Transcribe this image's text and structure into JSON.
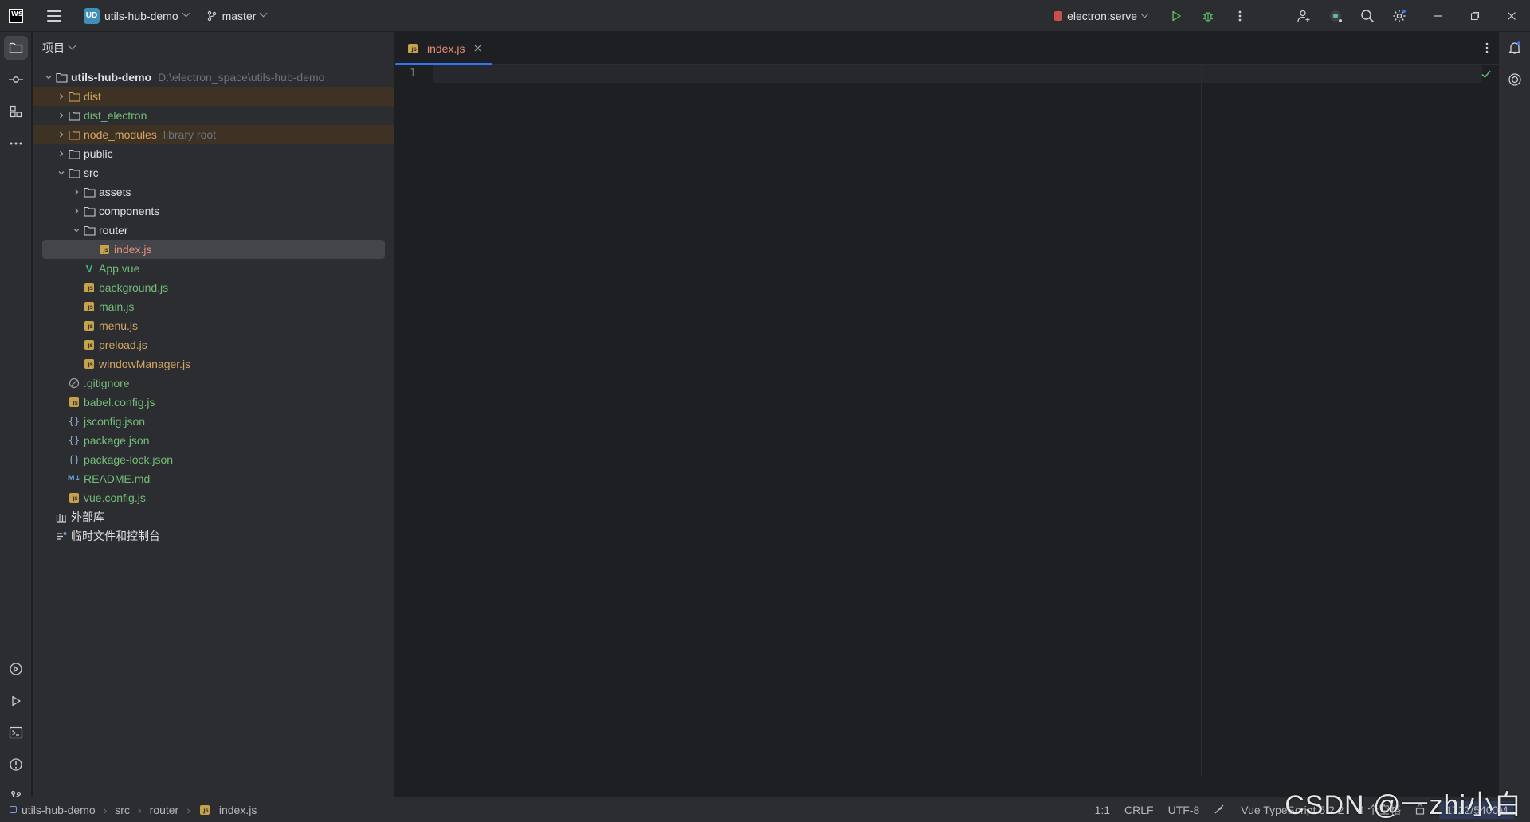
{
  "titlebar": {
    "logo_text": "WS",
    "project_badge": "UD",
    "project_name": "utils-hub-demo",
    "branch": "master",
    "run_config": "electron:serve"
  },
  "panel": {
    "title": "项目"
  },
  "tree": [
    {
      "label": "utils-hub-demo",
      "hint": "D:\\electron_space\\utils-hub-demo"
    },
    {
      "label": "dist"
    },
    {
      "label": "dist_electron"
    },
    {
      "label": "node_modules",
      "hint": "library root"
    },
    {
      "label": "public"
    },
    {
      "label": "src"
    },
    {
      "label": "assets"
    },
    {
      "label": "components"
    },
    {
      "label": "router"
    },
    {
      "label": "index.js"
    },
    {
      "label": "App.vue"
    },
    {
      "label": "background.js"
    },
    {
      "label": "main.js"
    },
    {
      "label": "menu.js"
    },
    {
      "label": "preload.js"
    },
    {
      "label": "windowManager.js"
    },
    {
      "label": ".gitignore"
    },
    {
      "label": "babel.config.js"
    },
    {
      "label": "jsconfig.json"
    },
    {
      "label": "package.json"
    },
    {
      "label": "package-lock.json"
    },
    {
      "label": "README.md"
    },
    {
      "label": "vue.config.js"
    },
    {
      "label": "外部库"
    },
    {
      "label": "临时文件和控制台"
    }
  ],
  "icons": {
    "js_badge": "JS",
    "md_badge": "M↓",
    "json_glyph": "{}",
    "vue_glyph": "V"
  },
  "editor": {
    "tab_label": "index.js",
    "line_number": "1"
  },
  "status": {
    "crumbs": [
      "utils-hub-demo",
      "src",
      "router",
      "index.js"
    ],
    "position": "1:1",
    "line_sep": "CRLF",
    "encoding": "UTF-8",
    "language": "Vue TypeScript 5.2.2",
    "indent": "4 个空格",
    "memory": "1722/5400M"
  },
  "watermark": "CSDN @一zhi小白",
  "colors": {
    "accent": "#3574f0",
    "excluded_bg": "#3d3223",
    "folder_excluded_text": "#d5a664",
    "modified_text": "#73bd79"
  }
}
